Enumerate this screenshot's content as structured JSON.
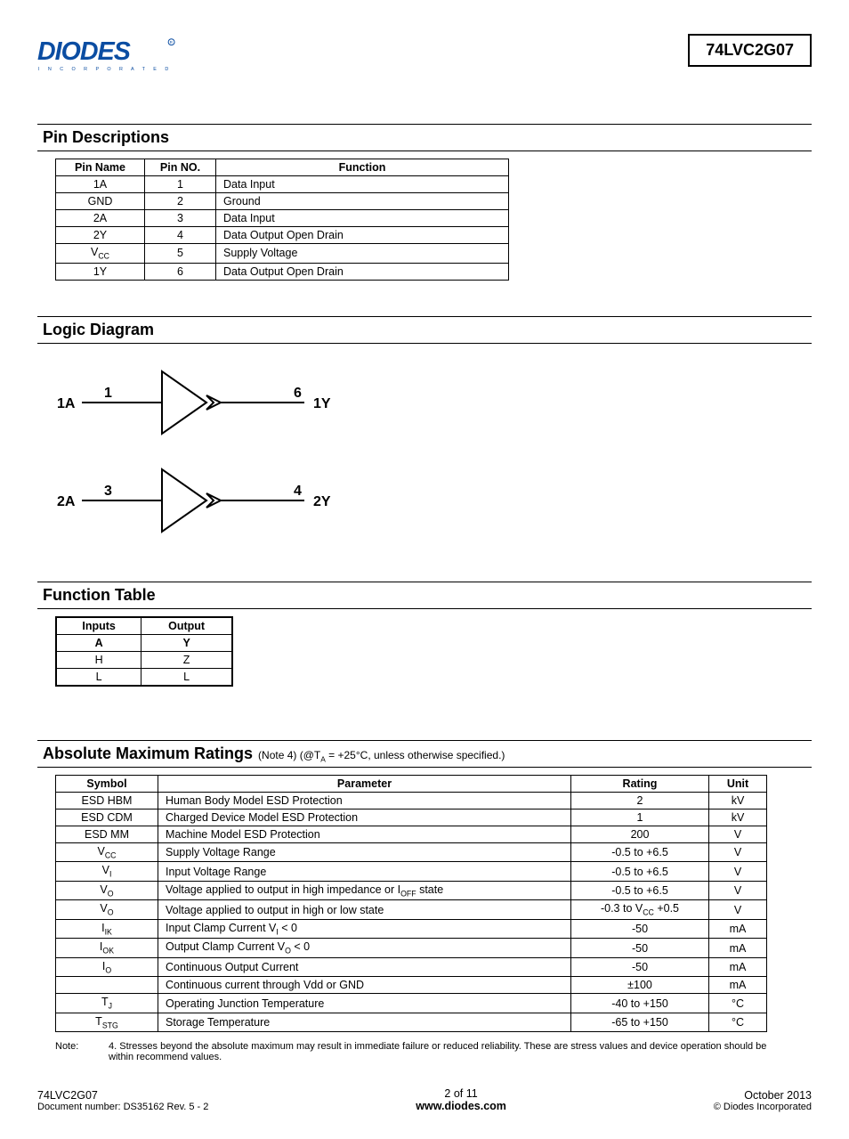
{
  "header": {
    "part_number": "74LVC2G07"
  },
  "sections": {
    "pin_desc_title": "Pin Descriptions",
    "logic_diagram_title": "Logic Diagram",
    "function_table_title": "Function Table",
    "amr_title": "Absolute Maximum Ratings",
    "amr_note_inline": "(Note 4) (@T",
    "amr_note_inline2": " = +25°C, unless otherwise specified.)"
  },
  "pin_table": {
    "headers": [
      "Pin Name",
      "Pin NO.",
      "Function"
    ],
    "rows": [
      [
        "1A",
        "1",
        "Data Input"
      ],
      [
        "GND",
        "2",
        "Ground"
      ],
      [
        "2A",
        "3",
        "Data Input"
      ],
      [
        "2Y",
        "4",
        "Data Output  Open Drain"
      ],
      [
        "V_CC",
        "5",
        "Supply Voltage"
      ],
      [
        "1Y",
        "6",
        "Data Output  Open Drain"
      ]
    ]
  },
  "logic_diagram": {
    "in1": "1A",
    "pin1": "1",
    "pin6": "6",
    "out1": "1Y",
    "in2": "2A",
    "pin3": "3",
    "pin4": "4",
    "out2": "2Y"
  },
  "func_table": {
    "headers": [
      "Inputs",
      "Output"
    ],
    "sub": [
      "A",
      "Y"
    ],
    "rows": [
      [
        "H",
        "Z"
      ],
      [
        "L",
        "L"
      ]
    ]
  },
  "amr_table": {
    "headers": [
      "Symbol",
      "Parameter",
      "Rating",
      "Unit"
    ],
    "rows": [
      {
        "sym": "ESD HBM",
        "param": "Human Body Model ESD Protection",
        "rating": "2",
        "unit": "kV"
      },
      {
        "sym": "ESD CDM",
        "param": "Charged Device Model ESD Protection",
        "rating": "1",
        "unit": "kV"
      },
      {
        "sym": "ESD MM",
        "param": "Machine Model ESD Protection",
        "rating": "200",
        "unit": "V"
      },
      {
        "sym": "V_CC",
        "param": "Supply Voltage Range",
        "rating": "-0.5 to +6.5",
        "unit": "V"
      },
      {
        "sym": "V_I",
        "param": "Input Voltage Range",
        "rating": "-0.5 to +6.5",
        "unit": "V"
      },
      {
        "sym": "V_O",
        "param": "Voltage applied to output in high impedance or I_OFF state",
        "rating": "-0.5 to +6.5",
        "unit": "V"
      },
      {
        "sym": "V_O",
        "param": "Voltage applied to output in high or low state",
        "rating": "-0.3 to V_CC +0.5",
        "unit": "V"
      },
      {
        "sym": "I_IK",
        "param": "Input Clamp Current V_I < 0",
        "rating": "-50",
        "unit": "mA"
      },
      {
        "sym": "I_OK",
        "param": "Output Clamp Current V_O < 0",
        "rating": "-50",
        "unit": "mA"
      },
      {
        "sym": "I_O",
        "param": "Continuous Output Current",
        "rating": "-50",
        "unit": "mA"
      },
      {
        "sym": "",
        "param": "Continuous current through Vdd or GND",
        "rating": "±100",
        "unit": "mA"
      },
      {
        "sym": "T_J",
        "param": "Operating Junction Temperature",
        "rating": "-40 to +150",
        "unit": "°C"
      },
      {
        "sym": "T_STG",
        "param": "Storage Temperature",
        "rating": "-65 to +150",
        "unit": "°C"
      }
    ]
  },
  "note": {
    "label": "Note:",
    "text": "4. Stresses beyond the absolute maximum may result in immediate failure or reduced reliability. These are stress values and device operation should be within recommend values."
  },
  "footer": {
    "left1": "74LVC2G07",
    "left2": "Document number: DS35162 Rev. 5 - 2",
    "center1": "2 of 11",
    "center2": "www.diodes.com",
    "right1": "October 2013",
    "right2": "© Diodes Incorporated"
  }
}
